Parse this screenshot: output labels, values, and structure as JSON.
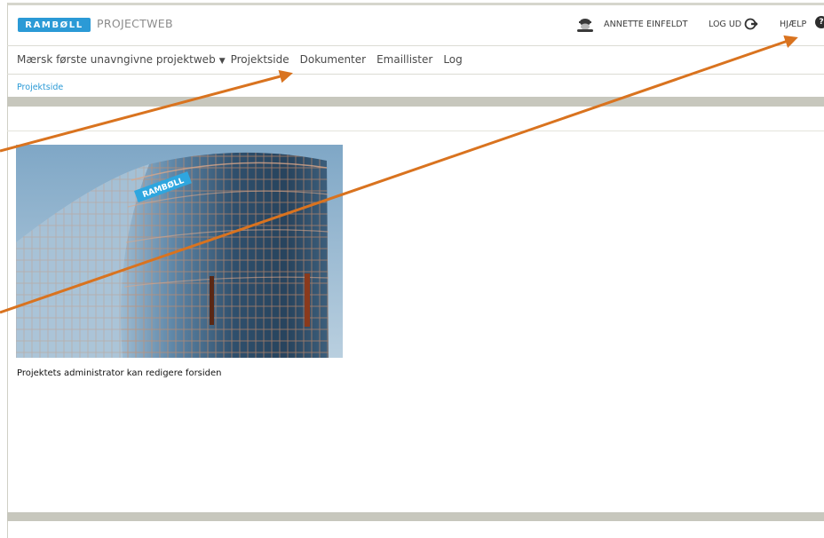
{
  "header": {
    "logo_text": "RAMBØLL",
    "app_name": "PROJECTWEB",
    "user_name": "ANNETTE EINFELDT",
    "logout_label": "LOG UD",
    "help_label": "HJÆLP"
  },
  "nav": {
    "project_selector": "Mærsk første unavngivne projektweb",
    "items": [
      "Projektside",
      "Dokumenter",
      "Emaillister",
      "Log"
    ]
  },
  "breadcrumb": "Projektside",
  "main": {
    "caption": "Projektets administrator kan redigere forsiden"
  },
  "colors": {
    "brand_blue": "#2b9ad6",
    "band_gray": "#c7c7bd",
    "annotation_orange": "#d9731f"
  },
  "icons": {
    "user": "user-avatar-icon",
    "logout": "logout-icon",
    "help": "help-icon",
    "chevron": "chevron-down-icon"
  }
}
